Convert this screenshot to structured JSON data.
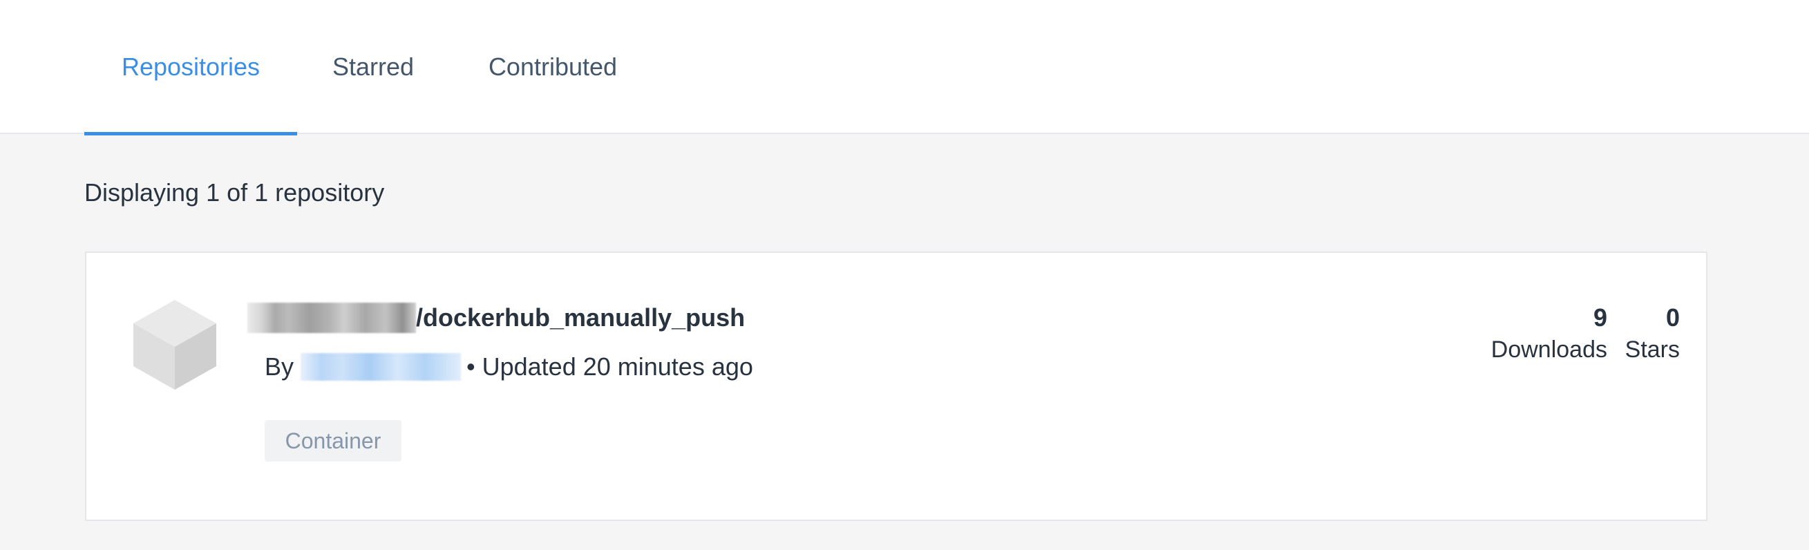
{
  "tabs": [
    {
      "label": "Repositories",
      "active": true
    },
    {
      "label": "Starred",
      "active": false
    },
    {
      "label": "Contributed",
      "active": false
    }
  ],
  "summary": {
    "count_text": "Displaying 1 of 1 repository"
  },
  "repository": {
    "name_suffix": "/dockerhub_manually_push",
    "by_label": "By",
    "updated_text": "• Updated 20 minutes ago",
    "tag": "Container",
    "downloads": {
      "value": "9",
      "label": "Downloads"
    },
    "stars": {
      "value": "0",
      "label": "Stars"
    },
    "icon": "cube-icon"
  },
  "colors": {
    "accent": "#3a8ee6",
    "text": "#28333f",
    "muted_tab": "#44566b",
    "page_bg": "#f5f5f5",
    "tag_bg": "#f0f2f4",
    "tag_text": "#8796a8"
  }
}
